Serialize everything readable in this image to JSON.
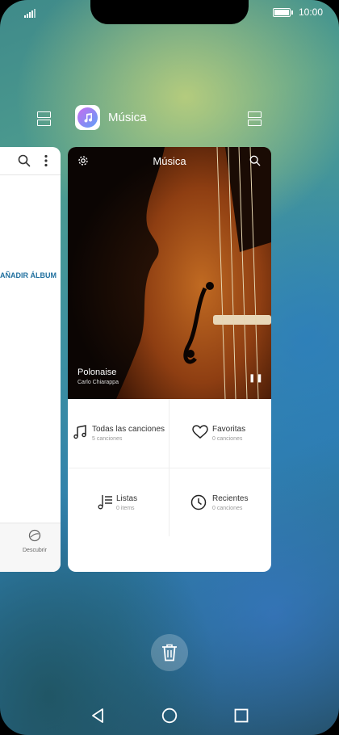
{
  "status": {
    "time": "10:00"
  },
  "app": {
    "title": "Música"
  },
  "left_card": {
    "add_album_label": "AÑADIR ÁLBUM",
    "discover_label": "Descubrir"
  },
  "main_card": {
    "header_title": "Música",
    "now_playing": {
      "title": "Polonaise",
      "artist": "Carlo Chiarappa"
    },
    "tiles": [
      {
        "label": "Todas las canciones",
        "sub": "5 canciones",
        "icon": "music-note-icon"
      },
      {
        "label": "Favoritas",
        "sub": "0 canciones",
        "icon": "heart-icon"
      },
      {
        "label": "Listas",
        "sub": "0 items",
        "icon": "playlist-icon"
      },
      {
        "label": "Recientes",
        "sub": "0 canciones",
        "icon": "clock-icon"
      }
    ]
  },
  "colors": {
    "accent_link": "#1f6f9e"
  }
}
